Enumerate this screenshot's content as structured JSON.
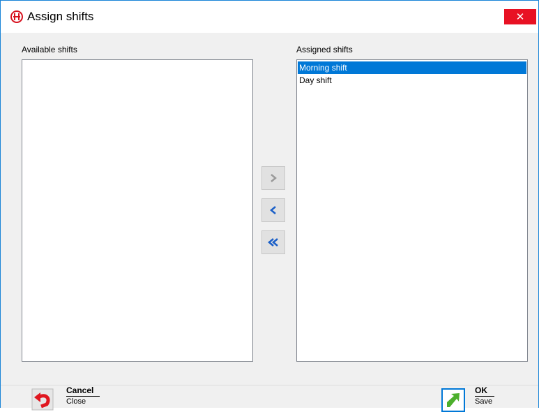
{
  "window": {
    "title": "Assign shifts",
    "close_glyph": "✕",
    "accent": "#0078d7",
    "close_color": "#e81123"
  },
  "available": {
    "label": "Available shifts",
    "items": []
  },
  "assigned": {
    "label": "Assigned shifts",
    "items": [
      {
        "label": "Morning shift",
        "selected": true
      },
      {
        "label": "Day shift",
        "selected": false
      }
    ]
  },
  "move_buttons": [
    {
      "name": "move-right-button",
      "icon": "chevron-right-icon",
      "glyph": "›",
      "enabled": false
    },
    {
      "name": "move-left-button",
      "icon": "chevron-left-icon",
      "glyph": "‹",
      "enabled": true
    },
    {
      "name": "move-all-left-button",
      "icon": "double-chevron-left-icon",
      "glyph": "«",
      "enabled": true
    }
  ],
  "footer": {
    "cancel": {
      "title": "Cancel",
      "subtitle": "Close",
      "icon": "undo-arrow-icon"
    },
    "ok": {
      "title": "OK",
      "subtitle": "Save",
      "icon": "green-arrow-icon"
    }
  }
}
